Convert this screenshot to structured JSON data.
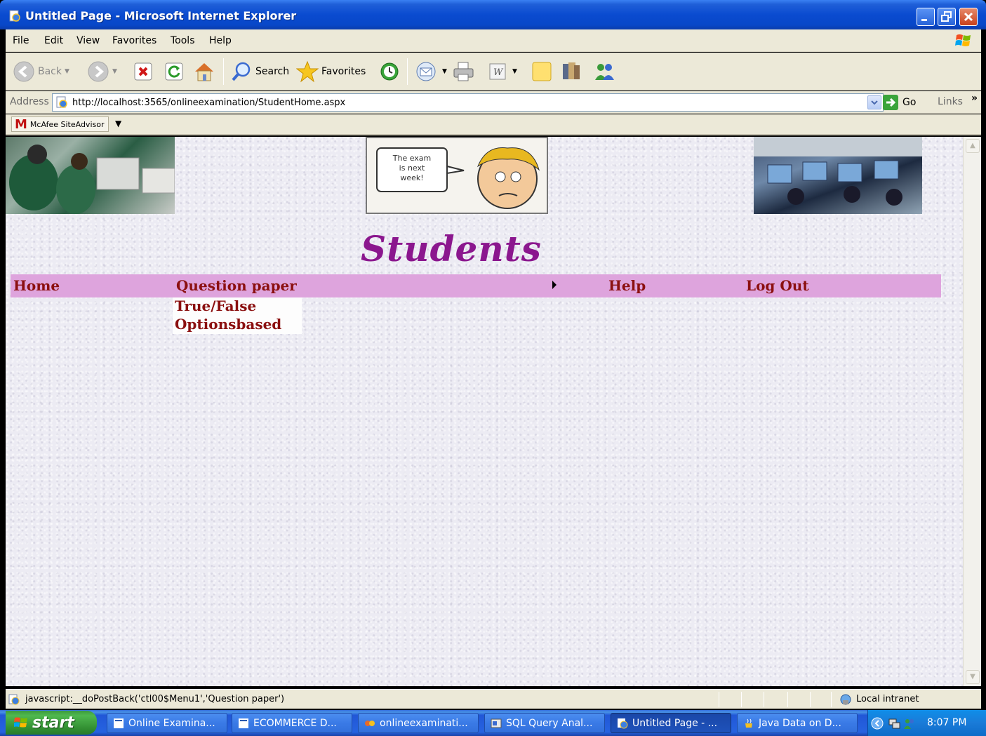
{
  "window": {
    "title": "Untitled Page - Microsoft Internet Explorer"
  },
  "menubar": {
    "items": [
      "File",
      "Edit",
      "View",
      "Favorites",
      "Tools",
      "Help"
    ]
  },
  "toolbar": {
    "back": "Back",
    "search": "Search",
    "favorites": "Favorites"
  },
  "address": {
    "label": "Address",
    "url": "http://localhost:3565/onlineexamination/StudentHome.aspx",
    "go": "Go",
    "links": "Links"
  },
  "mcafee": {
    "label": "McAfee SiteAdvisor"
  },
  "page": {
    "comic_text": "The exam is next week!",
    "heading": "Students",
    "nav": {
      "home": "Home",
      "question_paper": "Question paper",
      "help": "Help",
      "logout": "Log Out"
    },
    "submenu": [
      "True/False",
      "Optionsbased"
    ]
  },
  "status": {
    "text": "javascript:__doPostBack('ctl00$Menu1','Question paper')",
    "zone": "Local intranet"
  },
  "taskbar": {
    "start": "start",
    "tasks": [
      "Online Examina...",
      "ECOMMERCE D...",
      "onlineexaminati...",
      "SQL Query Anal...",
      "Untitled Page - ...",
      "Java Data on D..."
    ],
    "clock": "8:07 PM"
  },
  "colors": {
    "nav_bg": "#dea4dd",
    "nav_text": "#8b1010",
    "heading": "#8b178e",
    "titlebar": "#0a4bd0"
  }
}
